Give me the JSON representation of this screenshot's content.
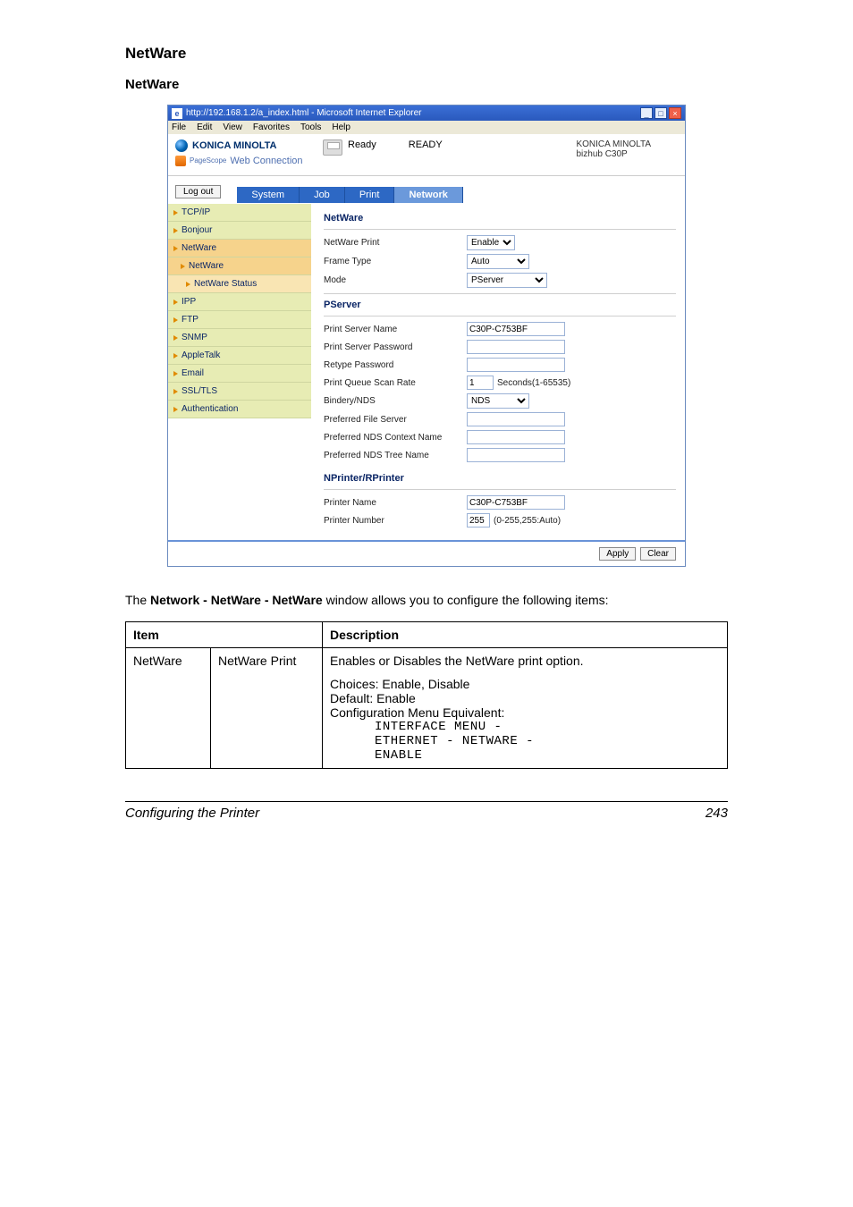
{
  "headings": {
    "h1": "NetWare",
    "h2": "NetWare"
  },
  "ie": {
    "title": "http://192.168.1.2/a_index.html - Microsoft Internet Explorer",
    "e_icon": "e",
    "menus": {
      "file": "File",
      "edit": "Edit",
      "view": "View",
      "favorites": "Favorites",
      "tools": "Tools",
      "help": "Help"
    },
    "ctrl": {
      "min": "_",
      "max": "□",
      "close": "×"
    }
  },
  "pw": {
    "brand": "KONICA MINOLTA",
    "pagescope": "PageScope",
    "webconn": "Web Connection",
    "ready_icon_label": "Ready",
    "ready_status": "READY",
    "header_right_brand": "KONICA MINOLTA",
    "header_right_model": "bizhub C30P",
    "logout": "Log out",
    "tabs": {
      "system": "System",
      "job": "Job",
      "print": "Print",
      "network": "Network"
    },
    "sidebar": {
      "tcpip": "TCP/IP",
      "bonjour": "Bonjour",
      "netware": "NetWare",
      "netware_sub": "NetWare",
      "netware_status": "NetWare Status",
      "ipp": "IPP",
      "ftp": "FTP",
      "snmp": "SNMP",
      "appletalk": "AppleTalk",
      "email": "Email",
      "ssltls": "SSL/TLS",
      "auth": "Authentication"
    }
  },
  "form": {
    "section_netware": "NetWare",
    "netware_print_label": "NetWare Print",
    "netware_print_value": "Enable",
    "frame_type_label": "Frame Type",
    "frame_type_value": "Auto",
    "mode_label": "Mode",
    "mode_value": "PServer",
    "section_pserver": "PServer",
    "psrv_name_label": "Print Server Name",
    "psrv_name_value": "C30P-C753BF",
    "psrv_pw_label": "Print Server Password",
    "retype_pw_label": "Retype Password",
    "scan_rate_label": "Print Queue Scan Rate",
    "scan_rate_value": "1",
    "scan_rate_unit": "Seconds(1-65535)",
    "bindery_label": "Bindery/NDS",
    "bindery_value": "NDS",
    "pref_file_label": "Preferred File Server",
    "pref_ctx_label": "Preferred NDS Context Name",
    "pref_tree_label": "Preferred NDS Tree Name",
    "section_np": "NPrinter/RPrinter",
    "printer_name_label": "Printer Name",
    "printer_name_value": "C30P-C753BF",
    "printer_num_label": "Printer Number",
    "printer_num_value": "255",
    "printer_num_unit": "(0-255,255:Auto)",
    "apply": "Apply",
    "clear": "Clear"
  },
  "caption": {
    "prefix": "The ",
    "bold": "Network - NetWare - NetWare",
    "suffix": " window allows you to configure the following items:"
  },
  "table": {
    "head_item": "Item",
    "head_desc": "Description",
    "row_item": "NetWare",
    "row_sub": "NetWare Print",
    "desc_line1": "Enables or Disables the NetWare print option.",
    "desc_choices": "Choices: Enable, Disable",
    "desc_default": "Default:  Enable",
    "desc_cfg": "Configuration Menu Equivalent:",
    "desc_path1": "INTERFACE MENU -",
    "desc_path2": "ETHERNET - NETWARE -",
    "desc_path3": "ENABLE"
  },
  "footer": {
    "left": "Configuring the Printer",
    "right": "243"
  }
}
